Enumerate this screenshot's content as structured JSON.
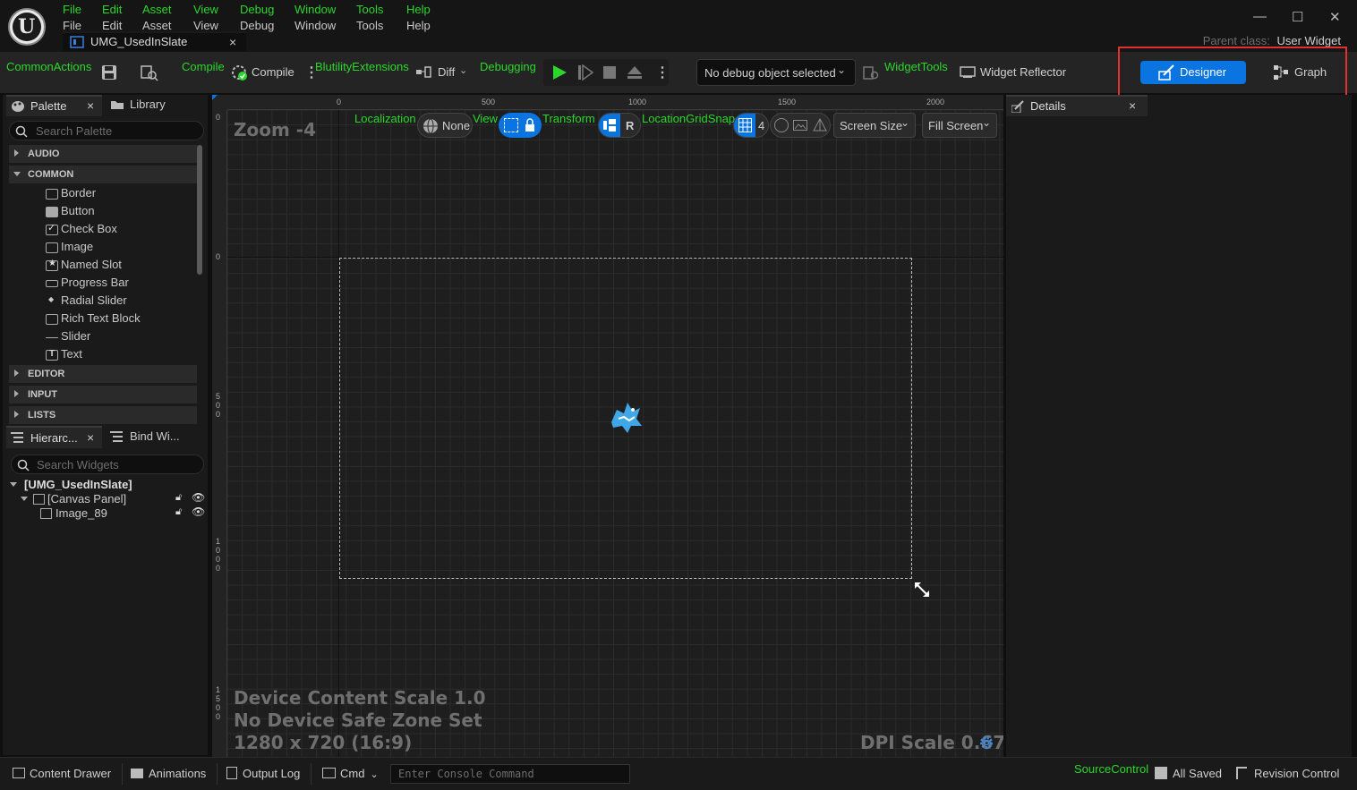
{
  "menu": {
    "green": [
      "File",
      "Edit",
      "Asset",
      "View",
      "Debug",
      "Window",
      "Tools",
      "Help"
    ],
    "white": [
      "File",
      "Edit",
      "Asset",
      "View",
      "Debug",
      "Window",
      "Tools",
      "Help"
    ]
  },
  "tab": {
    "title": "UMG_UsedInSlate",
    "close": "×"
  },
  "window": {
    "minimize": "—",
    "maximize": "☐",
    "close": "✕"
  },
  "parent_class": {
    "label": "Parent class:",
    "value": "User Widget"
  },
  "toolbar": {
    "common_actions": "CommonActions",
    "compile_section": "Compile",
    "compile_label": "Compile",
    "blutility": "BlutilityExtensions",
    "diff_label": "Diff",
    "debugging": "Debugging",
    "debug_object": "No debug object selected",
    "widget_tools": "WidgetTools",
    "widget_reflector": "Widget Reflector",
    "designer": "Designer",
    "graph": "Graph"
  },
  "palette": {
    "tab_palette": "Palette",
    "tab_library": "Library",
    "close": "×",
    "search_placeholder": "Search Palette",
    "categories": {
      "audio": "AUDIO",
      "common": "COMMON",
      "editor": "EDITOR",
      "input": "INPUT",
      "lists": "LISTS"
    },
    "items": [
      "Border",
      "Button",
      "Check Box",
      "Image",
      "Named Slot",
      "Progress Bar",
      "Radial Slider",
      "Rich Text Block",
      "Slider",
      "Text"
    ]
  },
  "hierarchy": {
    "tab_hierarchy": "Hierarc...",
    "tab_bind": "Bind Wi...",
    "close": "×",
    "search_placeholder": "Search Widgets",
    "root": "[UMG_UsedInSlate]",
    "canvas": "[Canvas Panel]",
    "image": "Image_89"
  },
  "viewport": {
    "zoom": "Zoom -4",
    "localization": "Localization",
    "localization_value": "None",
    "view": "View",
    "transform": "Transform",
    "transform_r": "R",
    "grid_snap": "LocationGridSnap",
    "grid_value": "4",
    "screen_size": "Screen Size",
    "fill_screen": "Fill Screen",
    "device_scale": "Device Content Scale 1.0",
    "safe_zone": "No Device Safe Zone Set",
    "resolution": "1280 x 720 (16:9)",
    "dpi": "DPI Scale 0.67",
    "ruler_h": [
      "0",
      "500",
      "1000",
      "1500",
      "2000"
    ],
    "ruler_v": [
      "0",
      "0",
      "500",
      "1000",
      "1500"
    ]
  },
  "details": {
    "title": "Details",
    "close": "×"
  },
  "bottom": {
    "content_drawer": "Content Drawer",
    "animations": "Animations",
    "output_log": "Output Log",
    "cmd": "Cmd",
    "console_placeholder": "Enter Console Command",
    "source_control": "SourceControl",
    "all_saved": "All Saved",
    "revision_control": "Revision Control"
  },
  "colors": {
    "accent": "#0a74e0",
    "green_label": "#2bd72b",
    "highlight_box": "#e03030"
  }
}
